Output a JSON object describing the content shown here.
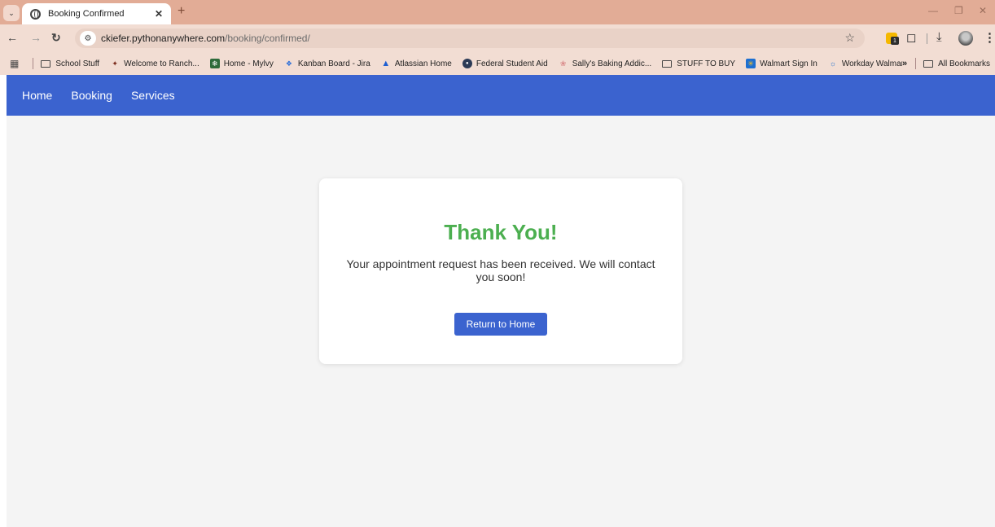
{
  "browser": {
    "tab_title": "Booking Confirmed",
    "url_host": "ckiefer.pythonanywhere.com",
    "url_path": "/booking/confirmed/",
    "bookmarks": [
      {
        "label": "School Stuff",
        "icon": "folder-icon"
      },
      {
        "label": "Welcome to Ranch...",
        "icon": "ranch-icon"
      },
      {
        "label": "Home - Mylvy",
        "icon": "mylvy-icon"
      },
      {
        "label": "Kanban Board - Jira",
        "icon": "jira-icon"
      },
      {
        "label": "Atlassian Home",
        "icon": "atlassian-icon"
      },
      {
        "label": "Federal Student Aid",
        "icon": "fsa-icon"
      },
      {
        "label": "Sally's Baking Addic...",
        "icon": "sallys-icon"
      },
      {
        "label": "STUFF TO BUY",
        "icon": "folder-icon"
      },
      {
        "label": "Walmart Sign In",
        "icon": "walmart-icon"
      },
      {
        "label": "Workday Walmart",
        "icon": "workday-icon"
      }
    ],
    "all_bookmarks_label": "All Bookmarks",
    "ext_badge_count": "1"
  },
  "page": {
    "nav": [
      {
        "label": "Home"
      },
      {
        "label": "Booking"
      },
      {
        "label": "Services"
      }
    ],
    "heading": "Thank You!",
    "message": "Your appointment request has been received. We will contact you soon!",
    "button_label": "Return to Home"
  },
  "colors": {
    "accent": "#3b63cf",
    "success": "#4caf50",
    "tabstrip": "#e2ac96"
  }
}
